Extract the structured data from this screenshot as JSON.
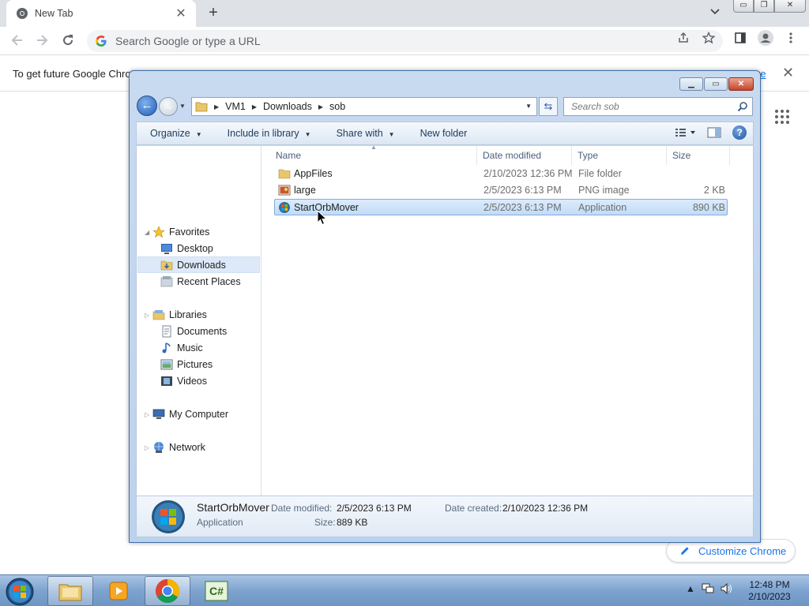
{
  "chrome": {
    "tab_title": "New Tab",
    "tab_close": "✕",
    "new_tab": "+",
    "omnibox_placeholder": "Search Google or type a URL",
    "infobar_text": "To get future Google Chro",
    "infobar_link_fragment": "re",
    "infobar_close": "✕",
    "customize_label": "Customize Chrome"
  },
  "explorer": {
    "breadcrumb": [
      "VM1",
      "Downloads",
      "sob"
    ],
    "search_placeholder": "Search sob",
    "commands": {
      "organize": "Organize",
      "include_in_library": "Include in library",
      "share_with": "Share with",
      "new_folder": "New folder"
    },
    "nav": {
      "favorites": "Favorites",
      "desktop": "Desktop",
      "downloads": "Downloads",
      "recent_places": "Recent Places",
      "libraries": "Libraries",
      "documents": "Documents",
      "music": "Music",
      "pictures": "Pictures",
      "videos": "Videos",
      "my_computer": "My Computer",
      "network": "Network"
    },
    "columns": {
      "name": "Name",
      "date_modified": "Date modified",
      "type": "Type",
      "size": "Size"
    },
    "files": [
      {
        "name": "AppFiles",
        "date": "2/10/2023 12:36 PM",
        "type": "File folder",
        "size": ""
      },
      {
        "name": "large",
        "date": "2/5/2023 6:13 PM",
        "type": "PNG image",
        "size": "2 KB"
      },
      {
        "name": "StartOrbMover",
        "date": "2/5/2023 6:13 PM",
        "type": "Application",
        "size": "890 KB"
      }
    ],
    "details": {
      "name": "StartOrbMover",
      "type": "Application",
      "date_modified_label": "Date modified:",
      "date_modified": "2/5/2023 6:13 PM",
      "date_created_label": "Date created:",
      "date_created": "2/10/2023 12:36 PM",
      "size_label": "Size:",
      "size": "889 KB"
    }
  },
  "taskbar": {
    "time": "12:48 PM",
    "date": "2/10/2023"
  },
  "colors": {
    "chrome_link": "#1a73e8",
    "selection": "#c2dcf7",
    "taskbar": "#7ea3cf"
  }
}
